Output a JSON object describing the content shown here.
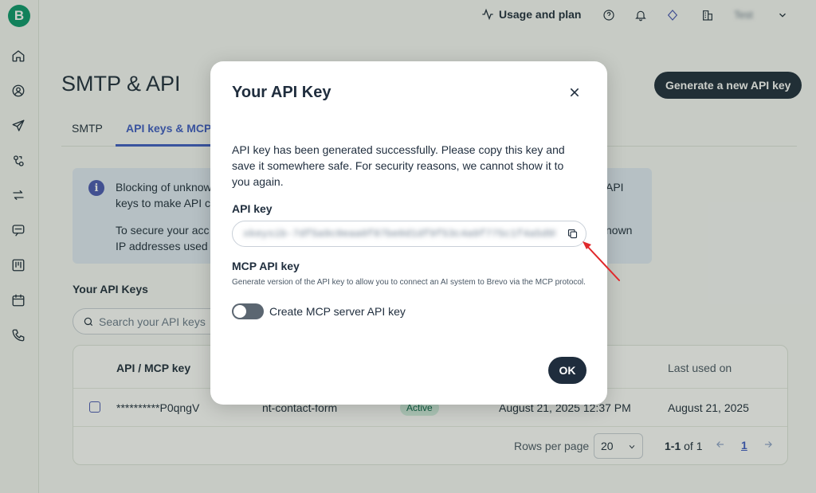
{
  "sidebar": {
    "logo": "B",
    "items": [
      {
        "icon": "home-icon"
      },
      {
        "icon": "contacts-icon"
      },
      {
        "icon": "send-icon"
      },
      {
        "icon": "automation-icon"
      },
      {
        "icon": "sync-icon"
      },
      {
        "icon": "conversations-icon"
      },
      {
        "icon": "board-icon"
      },
      {
        "icon": "calendar-icon"
      },
      {
        "icon": "phone-icon"
      }
    ]
  },
  "topbar": {
    "usage_label": "Usage and plan",
    "user_name": "Test"
  },
  "page": {
    "title": "SMTP & API",
    "generate_button": "Generate a new API key",
    "tabs": [
      {
        "label": "SMTP"
      },
      {
        "label": "API keys & MCP"
      }
    ],
    "info": {
      "line1_left": "Blocking of unknow",
      "line1_right": "API",
      "line2_left": "keys to make API c",
      "line3_left": "To secure your acc",
      "line3_right": "nown",
      "line4_left": "IP addresses used"
    },
    "api_keys_title": "Your API Keys",
    "search_placeholder": "Search your API keys",
    "table": {
      "headers": {
        "key": "API / MCP key",
        "last_used": "Last used on"
      },
      "rows": [
        {
          "key": "**********P0qngV",
          "name": "nt-contact-form",
          "status": "Active",
          "created": "August 21, 2025 12:37 PM",
          "last_used": "August 21, 2025"
        }
      ],
      "rows_per_page_label": "Rows per page",
      "rows_per_page_value": "20",
      "range_bold": "1-1",
      "range_rest": " of 1",
      "current_page": "1"
    }
  },
  "modal": {
    "title": "Your API Key",
    "description": "API key has been generated successfully. Please copy this key and save it somewhere safe. For security reasons, we cannot show it to you again.",
    "api_key_label": "API key",
    "api_key_value": "xkeysib-7df5a9c0eaa0f87be0d1df9f53c4a9f775c1f4a5d9b4b3e",
    "mcp_label": "MCP API key",
    "mcp_help": "Generate version of the API key to allow you to connect an AI system to Brevo via the MCP protocol.",
    "toggle_label": "Create MCP server API key",
    "ok_label": "OK"
  },
  "colors": {
    "brand_green": "#0b996e",
    "primary_dark": "#1f2d3d",
    "accent_blue": "#3f5dc6",
    "annotation_red": "#e0282b"
  }
}
